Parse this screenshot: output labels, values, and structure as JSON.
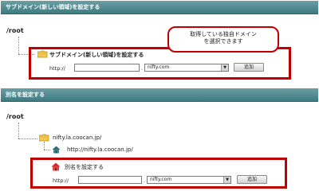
{
  "section1": {
    "header": "サブドメイン(新しい領域)を設定する",
    "root": "/root",
    "item_label": "サブドメイン(新しい領域)を設定する",
    "prefix": "http://",
    "dot": ".",
    "domain_selected": "nifty.com",
    "add_button": "追加",
    "callout_line1": "取得している独自ドメイン",
    "callout_line2": "を選択できます"
  },
  "section2": {
    "header": "別名を設定する",
    "root": "/root",
    "folder_label": "nifty.la.coocan.jp/",
    "url_label": "http://nifty.la.coocan.jp/",
    "item_label": "別名を設定する",
    "prefix": "http://",
    "dot": ".",
    "domain_selected": "nifty.com",
    "add_button": "追加"
  },
  "colors": {
    "header_bar": "#4f8a90",
    "highlight_red": "#c00000",
    "folder_yellow": "#f2c94c",
    "house_red": "#d22b2b",
    "house_teal": "#2f6f78"
  },
  "icons": {
    "folder": "folder-icon",
    "house_teal": "home-icon",
    "house_red": "home-icon"
  }
}
